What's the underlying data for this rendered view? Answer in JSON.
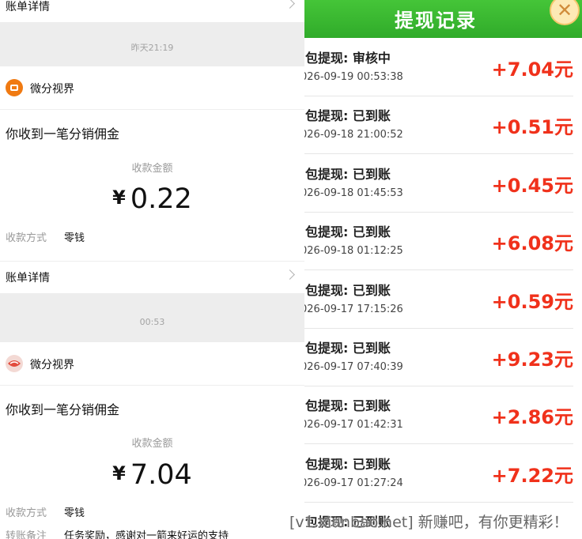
{
  "left": {
    "top_row": {
      "label": "账单详情"
    },
    "entries": [
      {
        "timestamp": "昨天21:19",
        "app_name": "微分视界",
        "title": "你收到一笔分销佣金",
        "amount_label": "收款金额",
        "currency": "¥",
        "amount": "0.22",
        "fields": [
          {
            "key": "收款方式",
            "value": "零钱"
          }
        ],
        "detail_label": "账单详情"
      },
      {
        "timestamp": "00:53",
        "app_name": "微分视界",
        "title": "你收到一笔分销佣金",
        "amount_label": "收款金额",
        "currency": "¥",
        "amount": "7.04",
        "fields": [
          {
            "key": "收款方式",
            "value": "零钱"
          },
          {
            "key": "转账备注",
            "value": "任务奖励，感谢对一箭来好运的支持"
          }
        ]
      }
    ]
  },
  "right": {
    "title": "提现记录",
    "close_icon": "close-icon",
    "records": [
      {
        "title": "I包提现: 审核中",
        "date": "026-09-19 00:53:38",
        "amount": "+7.04元"
      },
      {
        "title": "I包提现: 已到账",
        "date": "026-09-18 21:00:52",
        "amount": "+0.51元"
      },
      {
        "title": "I包提现: 已到账",
        "date": "026-09-18 01:45:53",
        "amount": "+0.45元"
      },
      {
        "title": "I包提现: 已到账",
        "date": "026-09-18 01:12:25",
        "amount": "+6.08元"
      },
      {
        "title": "I包提现: 已到账",
        "date": "026-09-17 17:15:26",
        "amount": "+0.59元"
      },
      {
        "title": "I包提现: 已到账",
        "date": "026-09-17 07:40:39",
        "amount": "+9.23元"
      },
      {
        "title": "I包提现: 已到账",
        "date": "026-09-17 01:42:31",
        "amount": "+2.86元"
      },
      {
        "title": "I包提现: 已到账",
        "date": "026-09-17 01:27:24",
        "amount": "+7.22元"
      },
      {
        "title": "I包提现: 已到账",
        "date": "",
        "amount": ""
      }
    ]
  },
  "watermark": "[v1.xianbao.net] 新赚吧，有你更精彩！",
  "colors": {
    "accent_green": "#39b830",
    "amount_red": "#f0311b",
    "app_icon_orange": "#f07a12"
  }
}
